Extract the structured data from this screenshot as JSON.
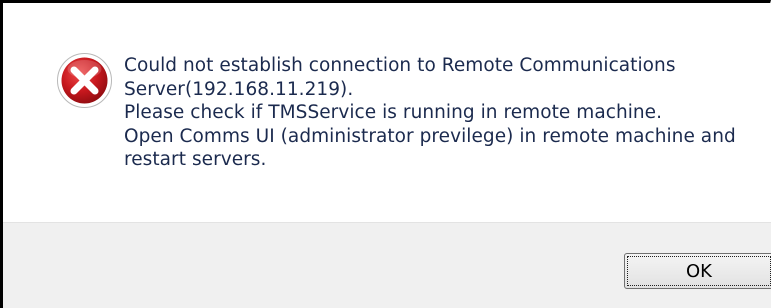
{
  "dialog": {
    "icon": "error-icon",
    "message_lines": [
      "Could not establish connection to Remote Communications",
      "Server(192.168.11.219).",
      "Please check if TMSService is running in remote machine.",
      "Open Comms UI (administrator previlege) in remote machine and",
      "restart servers."
    ],
    "ok_label": "OK"
  },
  "colors": {
    "icon_red": "#c8181e",
    "text": "#1b2a4e",
    "footer_bg": "#f0f0f0"
  }
}
